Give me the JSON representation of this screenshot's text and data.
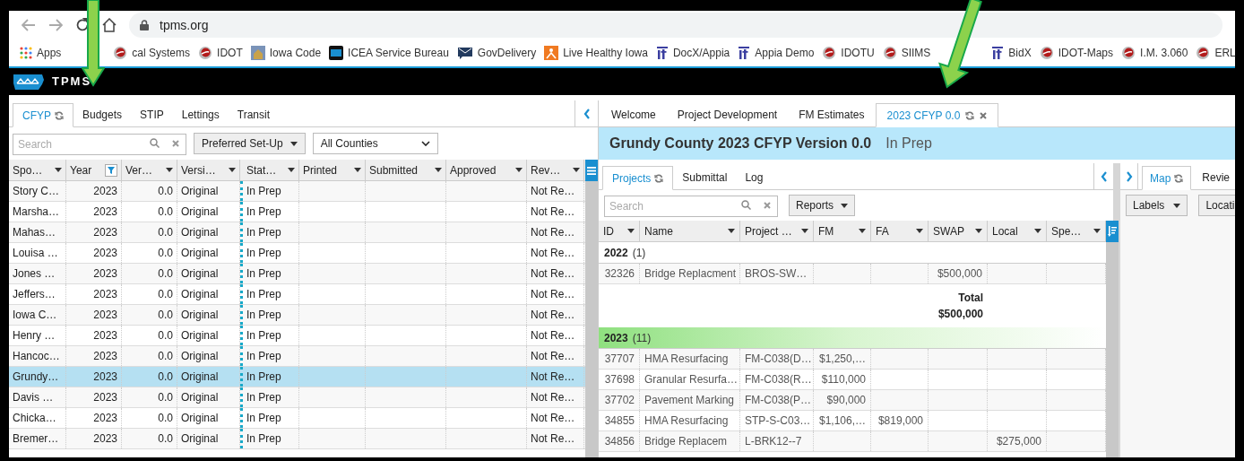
{
  "browser": {
    "url": "tpms.org",
    "bookmarks": [
      {
        "label": "Apps",
        "kind": "apps"
      },
      {
        "label": "cal Systems",
        "kind": "swirl"
      },
      {
        "label": "IDOT",
        "kind": "swirl"
      },
      {
        "label": "Iowa Code",
        "kind": "photo"
      },
      {
        "label": "ICEA Service Bureau",
        "kind": "square"
      },
      {
        "label": "GovDelivery",
        "kind": "mail"
      },
      {
        "label": "Live Healthy Iowa",
        "kind": "flame"
      },
      {
        "label": "DocX/Appia",
        "kind": "it"
      },
      {
        "label": "Appia Demo",
        "kind": "it"
      },
      {
        "label": "IDOTU",
        "kind": "swirl"
      },
      {
        "label": "SIIMS",
        "kind": "swirl"
      },
      {
        "label": "BidX",
        "kind": "it"
      },
      {
        "label": "IDOT-Maps",
        "kind": "swirl"
      },
      {
        "label": "I.M. 3.060",
        "kind": "swirl"
      },
      {
        "label": "ERL",
        "kind": "swirl"
      }
    ]
  },
  "app": {
    "title": "TPMS"
  },
  "left": {
    "tabs": [
      {
        "label": "CFYP",
        "selected": true,
        "refresh": true
      },
      {
        "label": "Budgets",
        "selected": false,
        "refresh": false
      },
      {
        "label": "STIP",
        "selected": false,
        "refresh": false
      },
      {
        "label": "Lettings",
        "selected": false,
        "refresh": false
      },
      {
        "label": "Transit",
        "selected": false,
        "refresh": false
      }
    ],
    "search": {
      "placeholder": "Search"
    },
    "setup_button": "Preferred Set-Up",
    "county_select": "All Counties",
    "columns": [
      {
        "label": "Spo…",
        "filtered": false
      },
      {
        "label": "Year",
        "filtered": true
      },
      {
        "label": "Ver…",
        "filtered": false
      },
      {
        "label": "Versi…",
        "filtered": false
      },
      {
        "label": "Stat…",
        "filtered": false
      },
      {
        "label": "Printed",
        "filtered": false
      },
      {
        "label": "Submitted",
        "filtered": false
      },
      {
        "label": "Approved",
        "filtered": false
      },
      {
        "label": "Rev…",
        "filtered": false
      }
    ],
    "rows": [
      {
        "sponsor": "Story C…",
        "year": "2023",
        "version_no": "0.0",
        "version": "Original",
        "status": "In Prep",
        "review": "Not Re…",
        "selected": false
      },
      {
        "sponsor": "Marsha…",
        "year": "2023",
        "version_no": "0.0",
        "version": "Original",
        "status": "In Prep",
        "review": "Not Re…",
        "selected": false
      },
      {
        "sponsor": "Mahas…",
        "year": "2023",
        "version_no": "0.0",
        "version": "Original",
        "status": "In Prep",
        "review": "Not Re…",
        "selected": false
      },
      {
        "sponsor": "Louisa …",
        "year": "2023",
        "version_no": "0.0",
        "version": "Original",
        "status": "In Prep",
        "review": "Not Re…",
        "selected": false
      },
      {
        "sponsor": "Jones …",
        "year": "2023",
        "version_no": "0.0",
        "version": "Original",
        "status": "In Prep",
        "review": "Not Re…",
        "selected": false
      },
      {
        "sponsor": "Jeffers…",
        "year": "2023",
        "version_no": "0.0",
        "version": "Original",
        "status": "In Prep",
        "review": "Not Re…",
        "selected": false
      },
      {
        "sponsor": "Iowa C…",
        "year": "2023",
        "version_no": "0.0",
        "version": "Original",
        "status": "In Prep",
        "review": "Not Re…",
        "selected": false
      },
      {
        "sponsor": "Henry …",
        "year": "2023",
        "version_no": "0.0",
        "version": "Original",
        "status": "In Prep",
        "review": "Not Re…",
        "selected": false
      },
      {
        "sponsor": "Hancoc…",
        "year": "2023",
        "version_no": "0.0",
        "version": "Original",
        "status": "In Prep",
        "review": "Not Re…",
        "selected": false
      },
      {
        "sponsor": "Grundy…",
        "year": "2023",
        "version_no": "0.0",
        "version": "Original",
        "status": "In Prep",
        "review": "Not Re…",
        "selected": true
      },
      {
        "sponsor": "Davis …",
        "year": "2023",
        "version_no": "0.0",
        "version": "Original",
        "status": "In Prep",
        "review": "Not Re…",
        "selected": false
      },
      {
        "sponsor": "Chicka…",
        "year": "2023",
        "version_no": "0.0",
        "version": "Original",
        "status": "In Prep",
        "review": "Not Re…",
        "selected": false
      },
      {
        "sponsor": "Bremer…",
        "year": "2023",
        "version_no": "0.0",
        "version": "Original",
        "status": "In Prep",
        "review": "Not Re…",
        "selected": false
      }
    ]
  },
  "right": {
    "tabs": [
      {
        "label": "Welcome",
        "selected": false,
        "refresh": false,
        "closable": false
      },
      {
        "label": "Project Development",
        "selected": false,
        "refresh": false,
        "closable": false
      },
      {
        "label": "FM Estimates",
        "selected": false,
        "refresh": false,
        "closable": false
      },
      {
        "label": "2023 CFYP 0.0",
        "selected": true,
        "refresh": true,
        "closable": true
      }
    ],
    "header": {
      "title": "Grundy County 2023 CFYP Version 0.0",
      "status": "In Prep"
    },
    "subtabs": [
      {
        "label": "Projects",
        "selected": true,
        "refresh": true
      },
      {
        "label": "Submittal",
        "selected": false,
        "refresh": false
      },
      {
        "label": "Log",
        "selected": false,
        "refresh": false
      }
    ],
    "search": {
      "placeholder": "Search"
    },
    "reports_button": "Reports",
    "columns": [
      "ID",
      "Name",
      "Project …",
      "FM",
      "FA",
      "SWAP",
      "Local",
      "Spe…"
    ],
    "groups": [
      {
        "label": "2022",
        "count": "(1)",
        "highlighted": false,
        "rows": [
          {
            "id": "32326",
            "name": "Bridge Replacment",
            "project": "BROS-SW…",
            "swap": "$500,000"
          }
        ],
        "total": {
          "label": "Total",
          "value": "$500,000"
        }
      },
      {
        "label": "2023",
        "count": "(11)",
        "highlighted": true,
        "rows": [
          {
            "id": "37707",
            "name": "HMA Resurfacing",
            "project": "FM-C038(D…",
            "fm": "$1,250,…"
          },
          {
            "id": "37698",
            "name": "Granular Resurfa…",
            "project": "FM-C038(R…",
            "fm": "$110,000"
          },
          {
            "id": "37702",
            "name": "Pavement Marking",
            "project": "FM-C038(P…",
            "fm": "$90,000"
          },
          {
            "id": "34855",
            "name": "HMA Resurfacing",
            "project": "STP-S-C03…",
            "fm": "$1,106,…",
            "fa": "$819,000"
          },
          {
            "id": "34856",
            "name": "Bridge Replacem",
            "project": "L-BRK12--7",
            "local": "$275,000"
          }
        ]
      }
    ],
    "side_tabs": [
      {
        "label": "Map",
        "selected": true,
        "refresh": true
      },
      {
        "label": "Revie",
        "selected": false,
        "refresh": false
      }
    ],
    "side_buttons": [
      {
        "label": "Labels",
        "caret": true
      },
      {
        "label": "Locati",
        "caret": false
      }
    ]
  }
}
